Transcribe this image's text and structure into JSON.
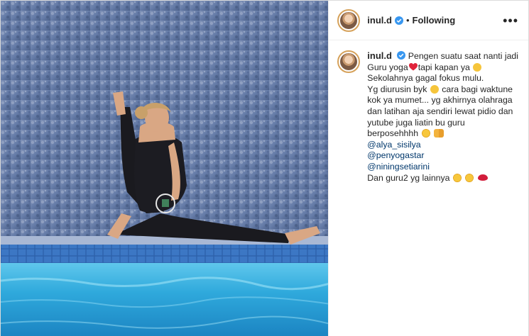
{
  "post": {
    "username": "inul.d",
    "follow_status": "Following",
    "separator": "•",
    "more_menu": "•••",
    "caption": {
      "username": "inul.d",
      "line1_text": "Pengen suatu saat nanti jadi",
      "line2_text_a": "Guru yoga",
      "line2_text_b": "tapi kapan ya",
      "line3": "Sekolahnya gagal fokus mulu.",
      "line4_a": "Yg diurusin byk",
      "line4_b": "cara bagi waktune",
      "line5": "kok ya mumet... yg akhirnya olahraga",
      "line6": "dan latihan aja sendiri lewat pidio dan",
      "line7": "yutube juga liatin bu guru",
      "line8": "berposehhhh",
      "mention1": "@alya_sisilya",
      "mention2": "@penyogastar",
      "mention3": "@niningsetiarini",
      "line_last": "Dan guru2 yg lainnya"
    }
  },
  "colors": {
    "verified_blue": "#3897f0",
    "mention_blue": "#00376b",
    "border": "#dbdbdb"
  },
  "icons": {
    "verified": "verified-badge-icon",
    "more": "more-options-icon"
  }
}
